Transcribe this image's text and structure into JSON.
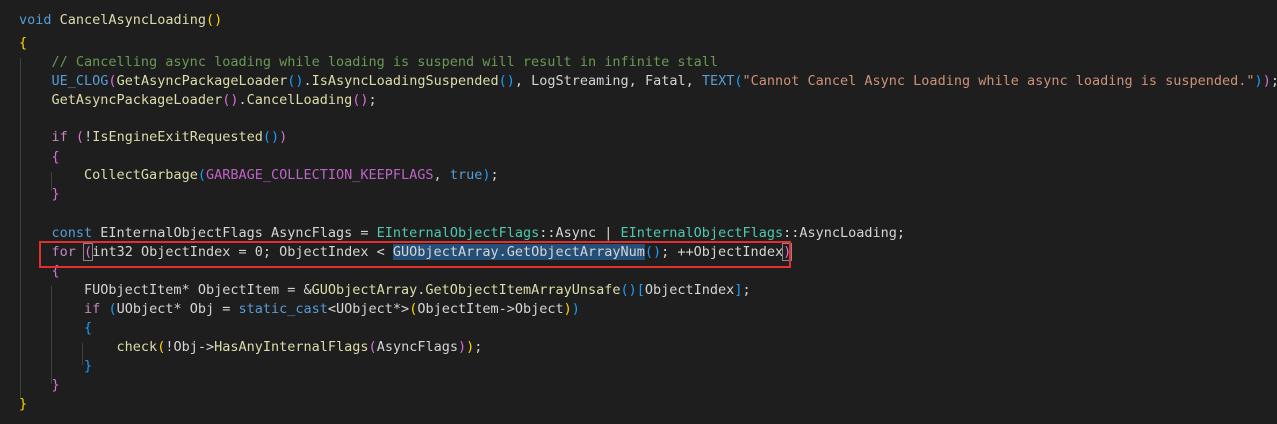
{
  "editor": {
    "theme_colors": {
      "background": "#1e1e1e",
      "keyword": "#569cd6",
      "control": "#c586c0",
      "function": "#dcdcaa",
      "type": "#4ec9b0",
      "string": "#ce9178",
      "comment": "#6a9955",
      "selection": "#264f78",
      "annotation_box": "#e03030"
    },
    "lines": [
      [
        [
          "kw",
          "void"
        ],
        [
          "plain",
          " "
        ],
        [
          "fn",
          "CancelAsyncLoading"
        ],
        [
          "b1",
          "()"
        ]
      ],
      [
        [
          "b1",
          "{"
        ]
      ],
      [
        [
          "plain",
          "    "
        ],
        [
          "cmt",
          "// Cancelling async loading while loading is suspend will result in infinite stall"
        ]
      ],
      [
        [
          "plain",
          "    "
        ],
        [
          "macro",
          "UE_CLOG"
        ],
        [
          "b2",
          "("
        ],
        [
          "fn",
          "GetAsyncPackageLoader"
        ],
        [
          "b3",
          "()"
        ],
        [
          "plain",
          "."
        ],
        [
          "fn",
          "IsAsyncLoadingSuspended"
        ],
        [
          "b3",
          "()"
        ],
        [
          "plain",
          ", "
        ],
        [
          "plain",
          "LogStreaming"
        ],
        [
          "plain",
          ", "
        ],
        [
          "plain",
          "Fatal"
        ],
        [
          "plain",
          ", "
        ],
        [
          "macro",
          "TEXT"
        ],
        [
          "b3",
          "("
        ],
        [
          "str",
          "\"Cannot Cancel Async Loading while async loading is suspended.\""
        ],
        [
          "b3",
          ")"
        ],
        [
          "b2",
          ")"
        ],
        [
          "plain",
          ";"
        ]
      ],
      [
        [
          "plain",
          "    "
        ],
        [
          "fn",
          "GetAsyncPackageLoader"
        ],
        [
          "b2",
          "()"
        ],
        [
          "plain",
          "."
        ],
        [
          "fn",
          "CancelLoading"
        ],
        [
          "b2",
          "()"
        ],
        [
          "plain",
          ";"
        ]
      ],
      [],
      [
        [
          "plain",
          "    "
        ],
        [
          "ctl",
          "if"
        ],
        [
          "plain",
          " "
        ],
        [
          "b2",
          "("
        ],
        [
          "plain",
          "!"
        ],
        [
          "fn",
          "IsEngineExitRequested"
        ],
        [
          "b3",
          "()"
        ],
        [
          "b2",
          ")"
        ]
      ],
      [
        [
          "plain",
          "    "
        ],
        [
          "b2",
          "{"
        ]
      ],
      [
        [
          "plain",
          "        "
        ],
        [
          "fn",
          "CollectGarbage"
        ],
        [
          "b3",
          "("
        ],
        [
          "mac2",
          "GARBAGE_COLLECTION_KEEPFLAGS"
        ],
        [
          "plain",
          ", "
        ],
        [
          "kw",
          "true"
        ],
        [
          "b3",
          ")"
        ],
        [
          "plain",
          ";"
        ]
      ],
      [
        [
          "plain",
          "    "
        ],
        [
          "b2",
          "}"
        ]
      ],
      [],
      [
        [
          "plain",
          "    "
        ],
        [
          "kw",
          "const"
        ],
        [
          "plain",
          " "
        ],
        [
          "plain",
          "EInternalObjectFlags"
        ],
        [
          "plain",
          " "
        ],
        [
          "plain",
          "AsyncFlags"
        ],
        [
          "plain",
          " = "
        ],
        [
          "type",
          "EInternalObjectFlags"
        ],
        [
          "plain",
          "::"
        ],
        [
          "plain",
          "Async"
        ],
        [
          "plain",
          " | "
        ],
        [
          "type",
          "EInternalObjectFlags"
        ],
        [
          "plain",
          "::"
        ],
        [
          "plain",
          "AsyncLoading"
        ],
        [
          "plain",
          ";"
        ]
      ],
      [
        [
          "plain",
          "    "
        ],
        [
          "ctl",
          "for"
        ],
        [
          "plain",
          " "
        ],
        [
          "b2m",
          "("
        ],
        [
          "plain",
          "int32 ObjectIndex = 0; ObjectIndex < "
        ],
        [
          "sel",
          "GUObjectArray.GetObjectArrayNum"
        ],
        [
          "b3",
          "()"
        ],
        [
          "plain",
          "; ++ObjectIndex"
        ],
        [
          "b2m",
          ")"
        ]
      ],
      [
        [
          "plain",
          "    "
        ],
        [
          "b2",
          "{"
        ]
      ],
      [
        [
          "plain",
          "        "
        ],
        [
          "plain",
          "FUObjectItem* ObjectItem = &"
        ],
        [
          "fn",
          "GUObjectArray"
        ],
        [
          "plain",
          "."
        ],
        [
          "fn",
          "GetObjectItemArrayUnsafe"
        ],
        [
          "b3",
          "()"
        ],
        [
          "b3",
          "["
        ],
        [
          "plain",
          "ObjectIndex"
        ],
        [
          "b3",
          "]"
        ],
        [
          "plain",
          ";"
        ]
      ],
      [
        [
          "plain",
          "        "
        ],
        [
          "ctl",
          "if"
        ],
        [
          "plain",
          " "
        ],
        [
          "b3",
          "("
        ],
        [
          "plain",
          "UObject* Obj = "
        ],
        [
          "kw",
          "static_cast"
        ],
        [
          "plain",
          "<UObject*>"
        ],
        [
          "b1",
          "("
        ],
        [
          "plain",
          "ObjectItem->Object"
        ],
        [
          "b1",
          ")"
        ],
        [
          "b3",
          ")"
        ]
      ],
      [
        [
          "plain",
          "        "
        ],
        [
          "b3",
          "{"
        ]
      ],
      [
        [
          "plain",
          "            "
        ],
        [
          "fn",
          "check"
        ],
        [
          "b1",
          "("
        ],
        [
          "plain",
          "!Obj->"
        ],
        [
          "fn",
          "HasAnyInternalFlags"
        ],
        [
          "b2",
          "("
        ],
        [
          "plain",
          "AsyncFlags"
        ],
        [
          "b2",
          ")"
        ],
        [
          "b1",
          ")"
        ],
        [
          "plain",
          ";"
        ]
      ],
      [
        [
          "plain",
          "        "
        ],
        [
          "b3",
          "}"
        ]
      ],
      [
        [
          "plain",
          "    "
        ],
        [
          "b2",
          "}"
        ]
      ],
      [
        [
          "b1",
          "}"
        ]
      ]
    ]
  }
}
